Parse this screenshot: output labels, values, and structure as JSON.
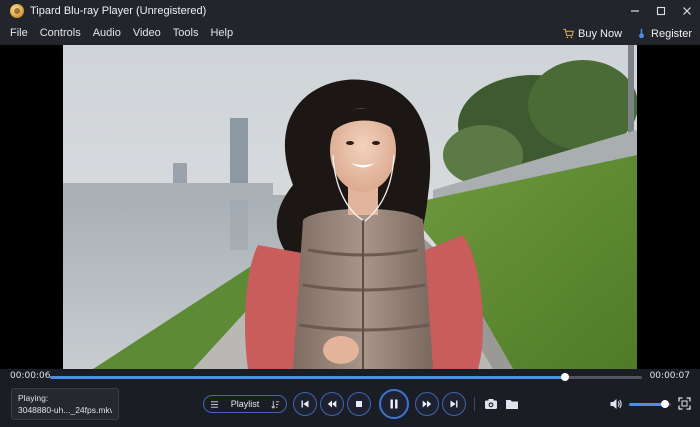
{
  "window": {
    "title": "Tipard Blu-ray Player (Unregistered)"
  },
  "menu": {
    "items": [
      "File",
      "Controls",
      "Audio",
      "Video",
      "Tools",
      "Help"
    ],
    "buy_now": "Buy Now",
    "register": "Register"
  },
  "playback": {
    "elapsed": "00:00:06",
    "total": "00:00:07",
    "progress_fraction": 0.87,
    "volume_fraction": 0.85
  },
  "now_playing": {
    "label": "Playing:",
    "file": "3048880-uh..._24fps.mkv"
  },
  "controls": {
    "playlist_label": "Playlist",
    "icons": [
      "playlist-menu-icon",
      "sort-icon",
      "previous-icon",
      "rewind-icon",
      "stop-icon",
      "pause-icon",
      "fast-forward-icon",
      "next-icon",
      "snapshot-icon",
      "folder-icon",
      "volume-icon",
      "fullscreen-icon"
    ]
  },
  "colors": {
    "accent": "#4c8fe8",
    "button_ring": "#3f66b0",
    "background": "#1b1d24",
    "bar": "#23252d"
  }
}
